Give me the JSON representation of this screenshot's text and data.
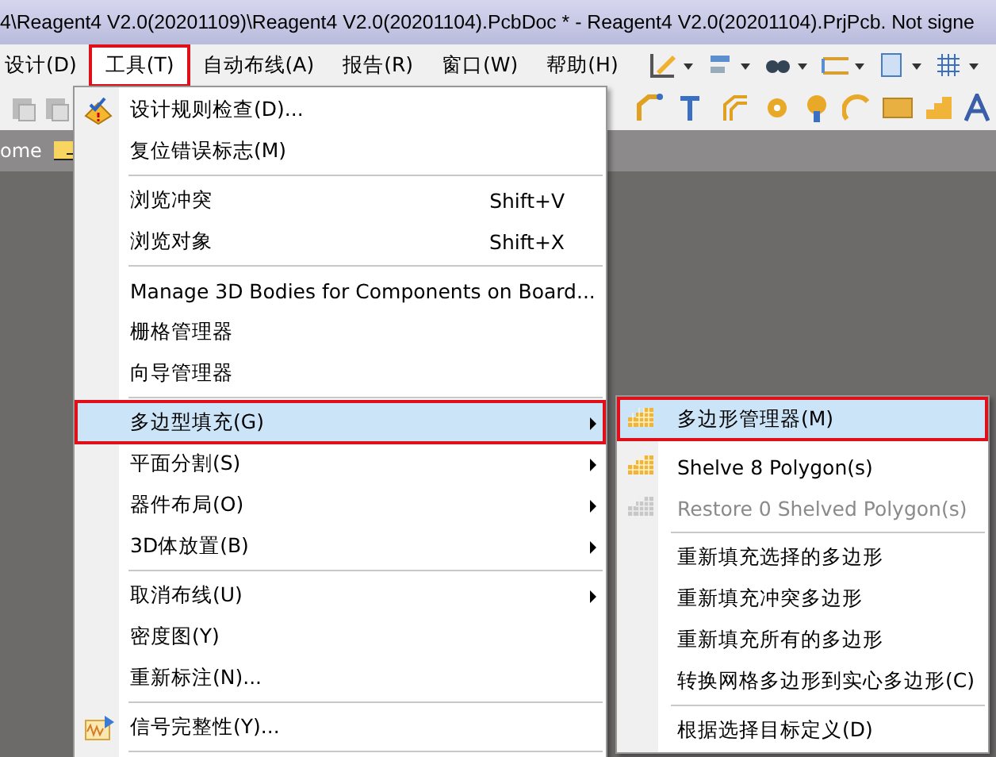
{
  "window": {
    "title": "4\\Reagent4 V2.0(20201109)\\Reagent4 V2.0(20201104).PcbDoc * - Reagent4 V2.0(20201104).PrjPcb. Not signe"
  },
  "menubar": [
    {
      "label": "设计(D)",
      "selected": false,
      "highlighted": false
    },
    {
      "label": "工具(T)",
      "selected": true,
      "highlighted": true
    },
    {
      "label": "自动布线(A)",
      "selected": false,
      "highlighted": false
    },
    {
      "label": "报告(R)",
      "selected": false,
      "highlighted": false
    },
    {
      "label": "窗口(W)",
      "selected": false,
      "highlighted": false
    },
    {
      "label": "帮助(H)",
      "selected": false,
      "highlighted": false
    }
  ],
  "tab_bar": {
    "label": "ome"
  },
  "tools_menu": [
    {
      "kind": "rulecheck",
      "label": "设计规则检查(D)...",
      "selected": false,
      "highlighted": false,
      "submenu": false
    },
    {
      "kind": "item",
      "label": "复位错误标志(M)",
      "selected": false,
      "highlighted": false,
      "submenu": false
    },
    {
      "kind": "separator"
    },
    {
      "kind": "item",
      "label": "浏览冲突",
      "shortcut": "Shift+V",
      "selected": false,
      "highlighted": false,
      "submenu": false
    },
    {
      "kind": "item",
      "label": "浏览对象",
      "shortcut": "Shift+X",
      "selected": false,
      "highlighted": false,
      "submenu": false
    },
    {
      "kind": "separator"
    },
    {
      "kind": "item",
      "label": "Manage 3D Bodies for Components on Board...",
      "selected": false,
      "highlighted": false,
      "submenu": false
    },
    {
      "kind": "item",
      "label": "栅格管理器",
      "selected": false,
      "highlighted": false,
      "submenu": false
    },
    {
      "kind": "item",
      "label": "向导管理器",
      "selected": false,
      "highlighted": false,
      "submenu": false
    },
    {
      "kind": "separator"
    },
    {
      "kind": "item",
      "label": "多边型填充(G)",
      "selected": true,
      "highlighted": true,
      "submenu": true
    },
    {
      "kind": "item",
      "label": "平面分割(S)",
      "selected": false,
      "highlighted": false,
      "submenu": true
    },
    {
      "kind": "item",
      "label": "器件布局(O)",
      "selected": false,
      "highlighted": false,
      "submenu": true
    },
    {
      "kind": "item",
      "label": "3D体放置(B)",
      "selected": false,
      "highlighted": false,
      "submenu": true
    },
    {
      "kind": "separator"
    },
    {
      "kind": "item",
      "label": "取消布线(U)",
      "selected": false,
      "highlighted": false,
      "submenu": true
    },
    {
      "kind": "item",
      "label": "密度图(Y)",
      "selected": false,
      "highlighted": false,
      "submenu": false
    },
    {
      "kind": "item",
      "label": "重新标注(N)...",
      "selected": false,
      "highlighted": false,
      "submenu": false
    },
    {
      "kind": "separator"
    },
    {
      "kind": "signal",
      "label": "信号完整性(Y)...",
      "selected": false,
      "highlighted": false,
      "submenu": false
    },
    {
      "kind": "separator"
    }
  ],
  "polygon_submenu": [
    {
      "kind": "polygon",
      "label": "多边形管理器(M)",
      "selected": true,
      "highlighted": true,
      "disabled": false
    },
    {
      "kind": "spacer"
    },
    {
      "kind": "polygon",
      "label": "Shelve 8 Polygon(s)",
      "selected": false,
      "highlighted": false,
      "disabled": false
    },
    {
      "kind": "polygon",
      "label": "Restore 0 Shelved Polygon(s)",
      "selected": false,
      "highlighted": false,
      "disabled": true
    },
    {
      "kind": "separator"
    },
    {
      "kind": "item",
      "label": "重新填充选择的多边形",
      "selected": false,
      "highlighted": false,
      "disabled": false
    },
    {
      "kind": "item",
      "label": "重新填充冲突多边形",
      "selected": false,
      "highlighted": false,
      "disabled": false
    },
    {
      "kind": "item",
      "label": "重新填充所有的多边形",
      "selected": false,
      "highlighted": false,
      "disabled": false
    },
    {
      "kind": "item",
      "label": "转换网格多边形到实心多边形(C)",
      "selected": false,
      "highlighted": false,
      "disabled": false
    },
    {
      "kind": "separator"
    },
    {
      "kind": "item",
      "label": "根据选择目标定义(D)",
      "selected": false,
      "highlighted": false,
      "disabled": false
    }
  ]
}
